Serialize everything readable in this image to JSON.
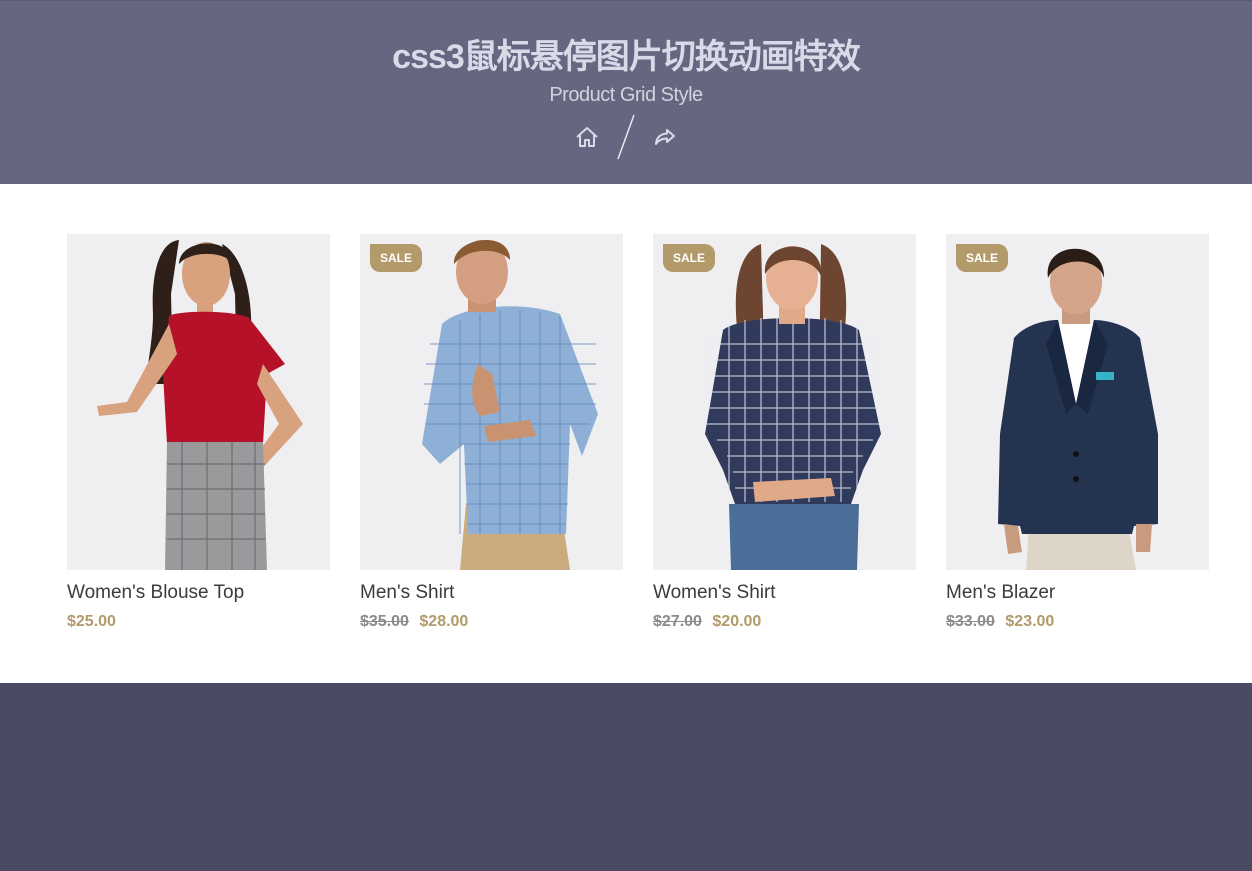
{
  "header": {
    "title": "css3鼠标悬停图片切换动画特效",
    "subtitle": "Product Grid Style"
  },
  "products": [
    {
      "name": "Women's Blouse Top",
      "old_price": "",
      "price": "$25.00",
      "badge": ""
    },
    {
      "name": "Men's Shirt",
      "old_price": "$35.00",
      "price": "$28.00",
      "badge": "SALE"
    },
    {
      "name": "Women's Shirt",
      "old_price": "$27.00",
      "price": "$20.00",
      "badge": "SALE"
    },
    {
      "name": "Men's Blazer",
      "old_price": "$33.00",
      "price": "$23.00",
      "badge": "SALE"
    }
  ],
  "colors": {
    "header_bg": "#666680",
    "accent": "#b39a6a",
    "footer_bg": "#4a4a63"
  }
}
